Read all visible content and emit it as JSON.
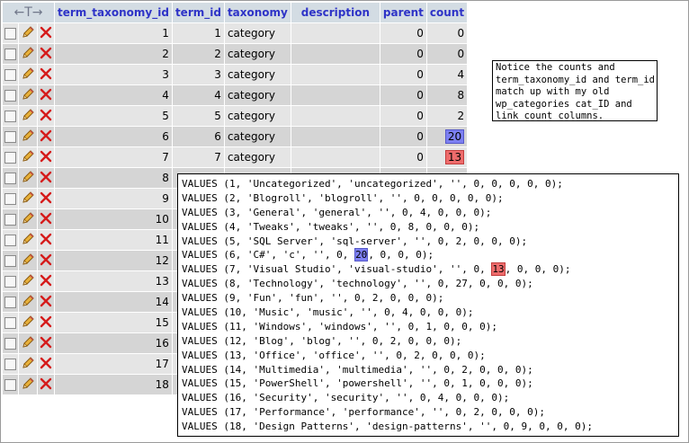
{
  "header": {
    "arrows": "←T→",
    "columns": [
      "term_taxonomy_id",
      "term_id",
      "taxonomy",
      "description",
      "parent",
      "count"
    ]
  },
  "rows": [
    {
      "term_taxonomy_id": "1",
      "term_id": "1",
      "taxonomy": "category",
      "description": "",
      "parent": "0",
      "count": "0"
    },
    {
      "term_taxonomy_id": "2",
      "term_id": "2",
      "taxonomy": "category",
      "description": "",
      "parent": "0",
      "count": "0"
    },
    {
      "term_taxonomy_id": "3",
      "term_id": "3",
      "taxonomy": "category",
      "description": "",
      "parent": "0",
      "count": "4"
    },
    {
      "term_taxonomy_id": "4",
      "term_id": "4",
      "taxonomy": "category",
      "description": "",
      "parent": "0",
      "count": "8"
    },
    {
      "term_taxonomy_id": "5",
      "term_id": "5",
      "taxonomy": "category",
      "description": "",
      "parent": "0",
      "count": "2"
    },
    {
      "term_taxonomy_id": "6",
      "term_id": "6",
      "taxonomy": "category",
      "description": "",
      "parent": "0",
      "count": "20",
      "highlight": "blue"
    },
    {
      "term_taxonomy_id": "7",
      "term_id": "7",
      "taxonomy": "category",
      "description": "",
      "parent": "0",
      "count": "13",
      "highlight": "red"
    },
    {
      "term_taxonomy_id": "8",
      "term_id": "",
      "taxonomy": "",
      "description": "",
      "parent": "",
      "count": ""
    },
    {
      "term_taxonomy_id": "9",
      "term_id": "",
      "taxonomy": "",
      "description": "",
      "parent": "",
      "count": ""
    },
    {
      "term_taxonomy_id": "10",
      "term_id": "",
      "taxonomy": "",
      "description": "",
      "parent": "",
      "count": ""
    },
    {
      "term_taxonomy_id": "11",
      "term_id": "",
      "taxonomy": "",
      "description": "",
      "parent": "",
      "count": ""
    },
    {
      "term_taxonomy_id": "12",
      "term_id": "",
      "taxonomy": "",
      "description": "",
      "parent": "",
      "count": ""
    },
    {
      "term_taxonomy_id": "13",
      "term_id": "",
      "taxonomy": "",
      "description": "",
      "parent": "",
      "count": ""
    },
    {
      "term_taxonomy_id": "14",
      "term_id": "",
      "taxonomy": "",
      "description": "",
      "parent": "",
      "count": ""
    },
    {
      "term_taxonomy_id": "15",
      "term_id": "",
      "taxonomy": "",
      "description": "",
      "parent": "",
      "count": ""
    },
    {
      "term_taxonomy_id": "16",
      "term_id": "",
      "taxonomy": "",
      "description": "",
      "parent": "",
      "count": ""
    },
    {
      "term_taxonomy_id": "17",
      "term_id": "",
      "taxonomy": "",
      "description": "",
      "parent": "",
      "count": ""
    },
    {
      "term_taxonomy_id": "18",
      "term_id": "",
      "taxonomy": "",
      "description": "",
      "parent": "",
      "count": ""
    }
  ],
  "icons": {
    "checkbox": "checkbox-icon",
    "edit": "pencil-icon",
    "delete": "delete-x-icon"
  },
  "colors": {
    "header_bg": "#d3dce3",
    "header_text": "#2e33c7",
    "row_odd": "#e5e5e5",
    "row_even": "#d5d5d5",
    "highlight_blue": "#7d80f2",
    "highlight_red": "#ee6c6c"
  },
  "note": "Notice the counts and\nterm_taxonomy_id and term_id\nmatch up with my old\nwp_categories cat_ID and\nlink_count columns.",
  "sql_lines": [
    "VALUES (1, 'Uncategorized', 'uncategorized', '', 0, 0, 0, 0, 0);",
    "VALUES (2, 'Blogroll', 'blogroll', '', 0, 0, 0, 0, 0);",
    "VALUES (3, 'General', 'general', '', 0, 4, 0, 0, 0);",
    "VALUES (4, 'Tweaks', 'tweaks', '', 0, 8, 0, 0, 0);",
    "VALUES (5, 'SQL Server', 'sql-server', '', 0, 2, 0, 0, 0);",
    "VALUES (6, 'C#', 'c', '', 0, 20, 0, 0, 0);",
    "VALUES (7, 'Visual Studio', 'visual-studio', '', 0, 13, 0, 0, 0);",
    "VALUES (8, 'Technology', 'technology', '', 0, 27, 0, 0, 0);",
    "VALUES (9, 'Fun', 'fun', '', 0, 2, 0, 0, 0);",
    "VALUES (10, 'Music', 'music', '', 0, 4, 0, 0, 0);",
    "VALUES (11, 'Windows', 'windows', '', 0, 1, 0, 0, 0);",
    "VALUES (12, 'Blog', 'blog', '', 0, 2, 0, 0, 0);",
    "VALUES (13, 'Office', 'office', '', 0, 2, 0, 0, 0);",
    "VALUES (14, 'Multimedia', 'multimedia', '', 0, 2, 0, 0, 0);",
    "VALUES (15, 'PowerShell', 'powershell', '', 0, 1, 0, 0, 0);",
    "VALUES (16, 'Security', 'security', '', 0, 4, 0, 0, 0);",
    "VALUES (17, 'Performance', 'performance', '', 0, 2, 0, 0, 0);",
    "VALUES (18, 'Design Patterns', 'design-patterns', '', 0, 9, 0, 0, 0);"
  ],
  "sql_highlights": [
    {
      "line": 5,
      "text": "20",
      "color": "blue"
    },
    {
      "line": 6,
      "text": "13",
      "color": "red"
    }
  ]
}
